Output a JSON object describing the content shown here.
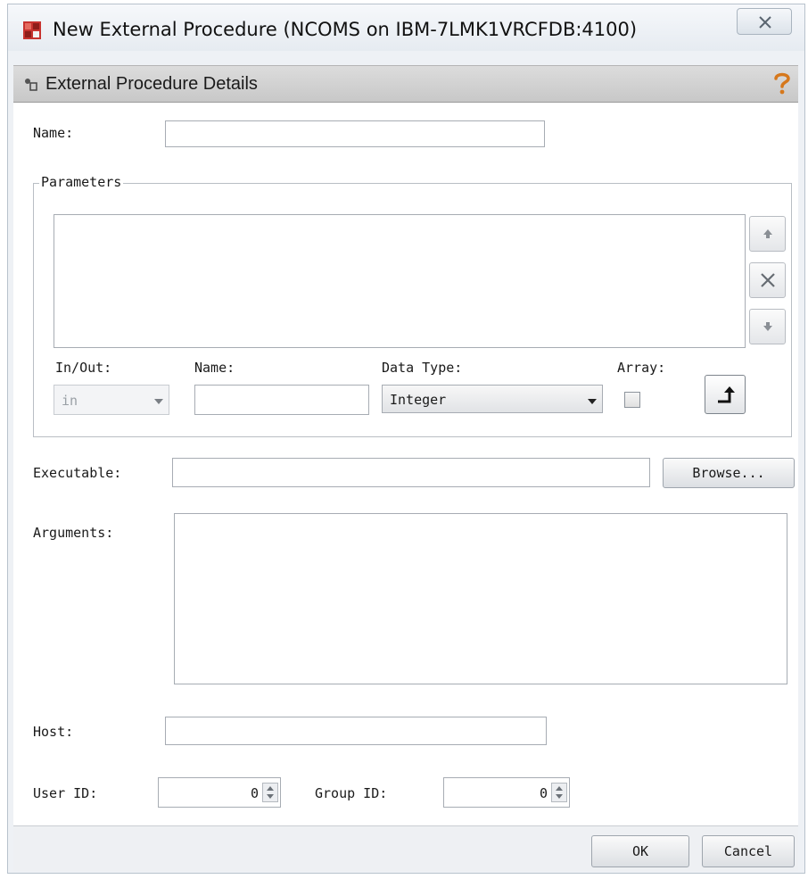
{
  "window": {
    "title": "New External Procedure (NCOMS on IBM-7LMK1VRCFDB:4100)",
    "app_icon": "red-grid-app-icon",
    "close_icon": "close-x-icon"
  },
  "header": {
    "title": "External Procedure Details",
    "help_icon": "question-mark-help-icon"
  },
  "form": {
    "name_label": "Name:",
    "name_value": "",
    "parameters": {
      "group_label": "Parameters",
      "list_items": [],
      "move_up_icon": "arrow-up-icon",
      "remove_icon": "x-delete-icon",
      "move_down_icon": "arrow-down-icon",
      "in_out_label": "In/Out:",
      "in_out_value": "in",
      "param_name_label": "Name:",
      "param_name_value": "",
      "data_type_label": "Data Type:",
      "data_type_value": "Integer",
      "array_label": "Array:",
      "array_checked": false,
      "add_icon": "insert-arrow-icon"
    },
    "executable_label": "Executable:",
    "executable_value": "",
    "browse_label": "Browse...",
    "arguments_label": "Arguments:",
    "arguments_value": "",
    "host_label": "Host:",
    "host_value": "",
    "user_id_label": "User ID:",
    "user_id_value": "0",
    "group_id_label": "Group ID:",
    "group_id_value": "0"
  },
  "footer": {
    "ok_label": "OK",
    "cancel_label": "Cancel"
  }
}
